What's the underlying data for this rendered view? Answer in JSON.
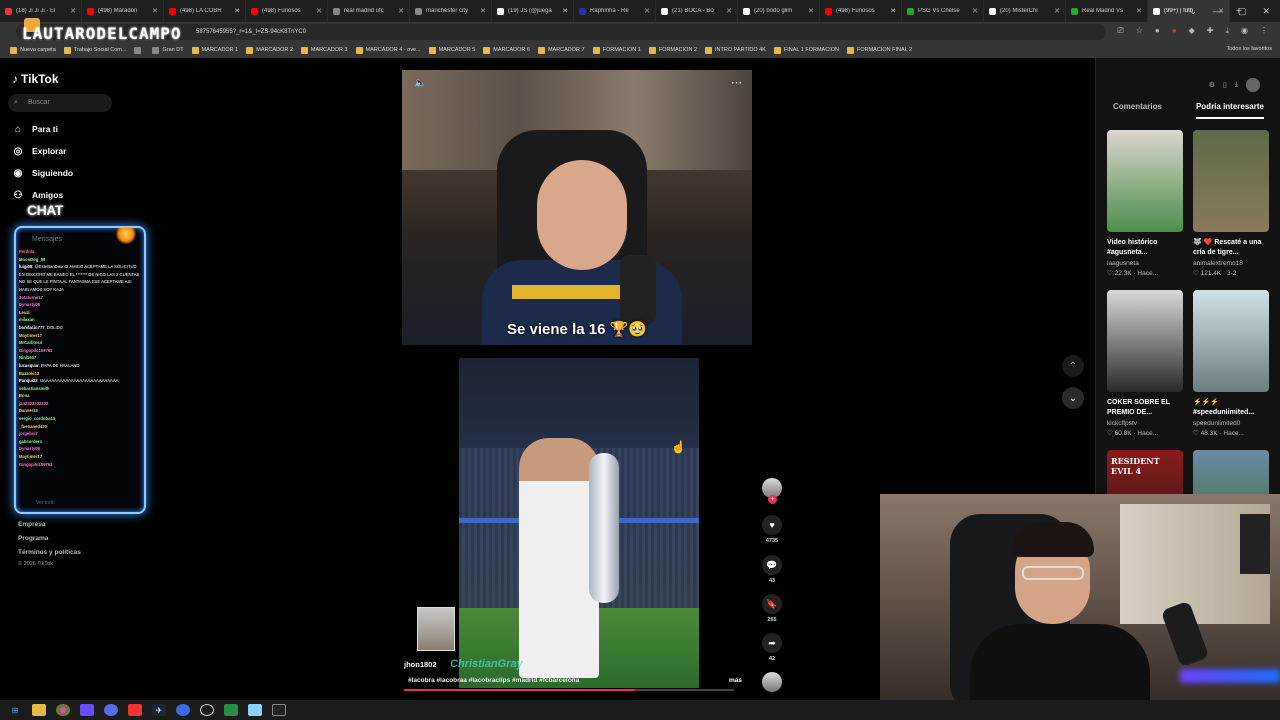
{
  "browser": {
    "tabs": [
      {
        "label": "(18) Ji Ji Ji - El",
        "color": "#e33"
      },
      {
        "label": "(498) Maradon",
        "color": "#f00"
      },
      {
        "label": "(498) LA COBR",
        "color": "#f00"
      },
      {
        "label": "(498) Furiosos",
        "color": "#f00"
      },
      {
        "label": "real madrid ufc",
        "color": "#888"
      },
      {
        "label": "manchester city",
        "color": "#888"
      },
      {
        "label": "(19) JS (@juega",
        "color": "#fff"
      },
      {
        "label": "Raphinha - Re",
        "color": "#23a"
      },
      {
        "label": "(21) BOCA - Bo",
        "color": "#fff"
      },
      {
        "label": "(20) bodo glim",
        "color": "#fff"
      },
      {
        "label": "(498) Furiosos",
        "color": "#f00"
      },
      {
        "label": "PSG Vs Chelse",
        "color": "#2a2"
      },
      {
        "label": "(20) MisterChi",
        "color": "#fff"
      },
      {
        "label": "Real Madrid Vs",
        "color": "#2a2"
      },
      {
        "label": "(99+) | fútb",
        "color": "#fff"
      }
    ],
    "url": "58757645955?_r=1&_t=ZS-94cK8TnYC0",
    "overlay_logo": "LAUTARODELCAMPO",
    "bookmarks": [
      {
        "label": "Nueva carpeta",
        "color": "#e6b84a"
      },
      {
        "label": "Trabajo Social Com...",
        "color": "#e6b84a"
      },
      {
        "label": "",
        "color": "#888"
      },
      {
        "label": "Gran DT",
        "color": "#888"
      },
      {
        "label": "MARCADOR 1",
        "color": "#e6b84a"
      },
      {
        "label": "MARCADOR 2",
        "color": "#e6b84a"
      },
      {
        "label": "MARCADOR 3",
        "color": "#e6b84a"
      },
      {
        "label": "MARCADOR 4 - ove...",
        "color": "#e6b84a"
      },
      {
        "label": "MARCADOR 5",
        "color": "#e6b84a"
      },
      {
        "label": "MARCADOR 6",
        "color": "#e6b84a"
      },
      {
        "label": "MARCADOR 7",
        "color": "#e6b84a"
      },
      {
        "label": "FORMACION 1",
        "color": "#e6b84a"
      },
      {
        "label": "FORMACION 2",
        "color": "#e6b84a"
      },
      {
        "label": "INTRO PARTIDO 4K",
        "color": "#e6b84a"
      },
      {
        "label": "FINAL 1 FORMACION",
        "color": "#e6b84a"
      },
      {
        "label": "FORMACION FINAL 2",
        "color": "#e6b84a"
      }
    ],
    "bookmarks_right": "Todos los favoritos"
  },
  "tiktok": {
    "logo": "TikTok",
    "search_placeholder": "Buscar",
    "nav": [
      {
        "label": "Para ti",
        "icon": "home-icon"
      },
      {
        "label": "Explorar",
        "icon": "compass-icon"
      },
      {
        "label": "Siguiendo",
        "icon": "following-icon"
      },
      {
        "label": "Amigos",
        "icon": "friends-icon"
      }
    ],
    "footer_links": [
      "Empresa",
      "Programa",
      "Términos y políticas"
    ],
    "copyright": "© 2026 TikTok"
  },
  "chat": {
    "label": "CHAT",
    "header": "Mensajes",
    "lines": [
      {
        "user": "Perdida",
        "text": "",
        "color": "#ff6b6b"
      },
      {
        "user": "MoonDog_99",
        "text": "",
        "color": "#8cff8c"
      },
      {
        "user": "luigi08",
        "text": ": @EsteBanDaur42 AMIGO ACEPTAME LA SOLICITUD EN DISCORD ME BANEO EL ******* DE NICO LAS 2 CUENTAS NO SE QUE LE PINTA AL FANTASMA ESE ACEPTAME ASI HABLAMOS SOY KAJA",
        "color": "#fff"
      },
      {
        "user": "Jotaturno17",
        "text": "",
        "color": "#ff7ad1"
      },
      {
        "user": "Dynasty09",
        "text": "",
        "color": "#ff7ad1"
      },
      {
        "user": "Leuzi",
        "text": "",
        "color": "#ffd54a"
      },
      {
        "user": "milaxan",
        "text": "",
        "color": "#8cff8c"
      },
      {
        "user": "bonifacio777",
        "text": ": DOLIDO",
        "color": "#fff"
      },
      {
        "user": "Maytimer17",
        "text": "",
        "color": "#ffd54a"
      },
      {
        "user": "MrCarlitos4",
        "text": "",
        "color": "#8cff8c"
      },
      {
        "user": "Gingopilo159763",
        "text": "",
        "color": "#ff7ad1"
      },
      {
        "user": "Nini1607",
        "text": "",
        "color": "#8cff8c"
      },
      {
        "user": "lucasquar",
        "text": ": PAPA DE HAALAND",
        "color": "#fff"
      },
      {
        "user": "Bazzoki13",
        "text": "",
        "color": "#ffd54a"
      },
      {
        "user": "Panqui22",
        "text": ": UAAAAAAAAAAAAAAAAAAAAAAAAAAA",
        "color": "#fff"
      },
      {
        "user": "sebastiansmith",
        "text": "",
        "color": "#8cff8c"
      },
      {
        "user": "Bona",
        "text": "",
        "color": "#ffd54a"
      },
      {
        "user": "jan2323232232",
        "text": "",
        "color": "#ff7ad1"
      },
      {
        "user": "Danver13",
        "text": "",
        "color": "#ffd54a"
      },
      {
        "user": "sergio_cordoba13",
        "text": "",
        "color": "#8cff8c"
      },
      {
        "user": "_fuenaned430",
        "text": "",
        "color": "#ffd54a"
      },
      {
        "user": "jorgeboi7",
        "text": "",
        "color": "#ff7ad1"
      },
      {
        "user": "gabcordero",
        "text": "",
        "color": "#8cff8c"
      },
      {
        "user": "Dynasty09",
        "text": "",
        "color": "#ff7ad1"
      },
      {
        "user": "Maytimer17",
        "text": "",
        "color": "#ffd54a"
      },
      {
        "user": "Gingopilo159763",
        "text": "",
        "color": "#ff7ad1"
      }
    ],
    "footer": "Ver todo"
  },
  "video1": {
    "caption": "Se viene la 16 🏆🥹"
  },
  "video2": {
    "author": "jhon1802",
    "overlay_text": "ChristianGray",
    "hashtags": "#lacobra #lacobraa #lacobraclips #madrid #fcbarcelona",
    "more": "más",
    "progress": 0.7
  },
  "actions": {
    "likes": "4735",
    "comments": "43",
    "saves": "265",
    "shares": "42"
  },
  "right_panel": {
    "tabs": [
      "Comentarios",
      "Podría interesarte"
    ],
    "active_tab": 1,
    "cards": [
      {
        "title": "Video histórico #agusneta...",
        "user": "laagusneta",
        "stats": "♡ 22.3K · Hace...",
        "c1": "#dcd6cf",
        "c2": "#4a8f4a"
      },
      {
        "title": "🐺 ❤️ Rescaté a una cría de tigre...",
        "user": "animalextremo18",
        "stats": "♡ 121.4K · 3-2",
        "c1": "#5e6b4a",
        "c2": "#8a7a5a"
      },
      {
        "title": "COKER SOBRE EL PREMIO DE...",
        "user": "kickcftpstv",
        "stats": "♡ 60.8K · Hace...",
        "c1": "#d8d8d8",
        "c2": "#2a2a2a"
      },
      {
        "title": "⚡⚡⚡ #speedunlimited...",
        "user": "speedunlimited0",
        "stats": "♡ 48.3K · Hace...",
        "c1": "#cfe4e6",
        "c2": "#6a7e7e"
      },
      {
        "title": "",
        "user": "",
        "stats": "",
        "c1": "#8a1a1a",
        "c2": "#2a1a1a"
      },
      {
        "title": "",
        "user": "",
        "stats": "",
        "c1": "#6a8aa8",
        "c2": "#3a6a2a"
      }
    ],
    "card5_overlay": "RESIDENT EVIL 4"
  }
}
